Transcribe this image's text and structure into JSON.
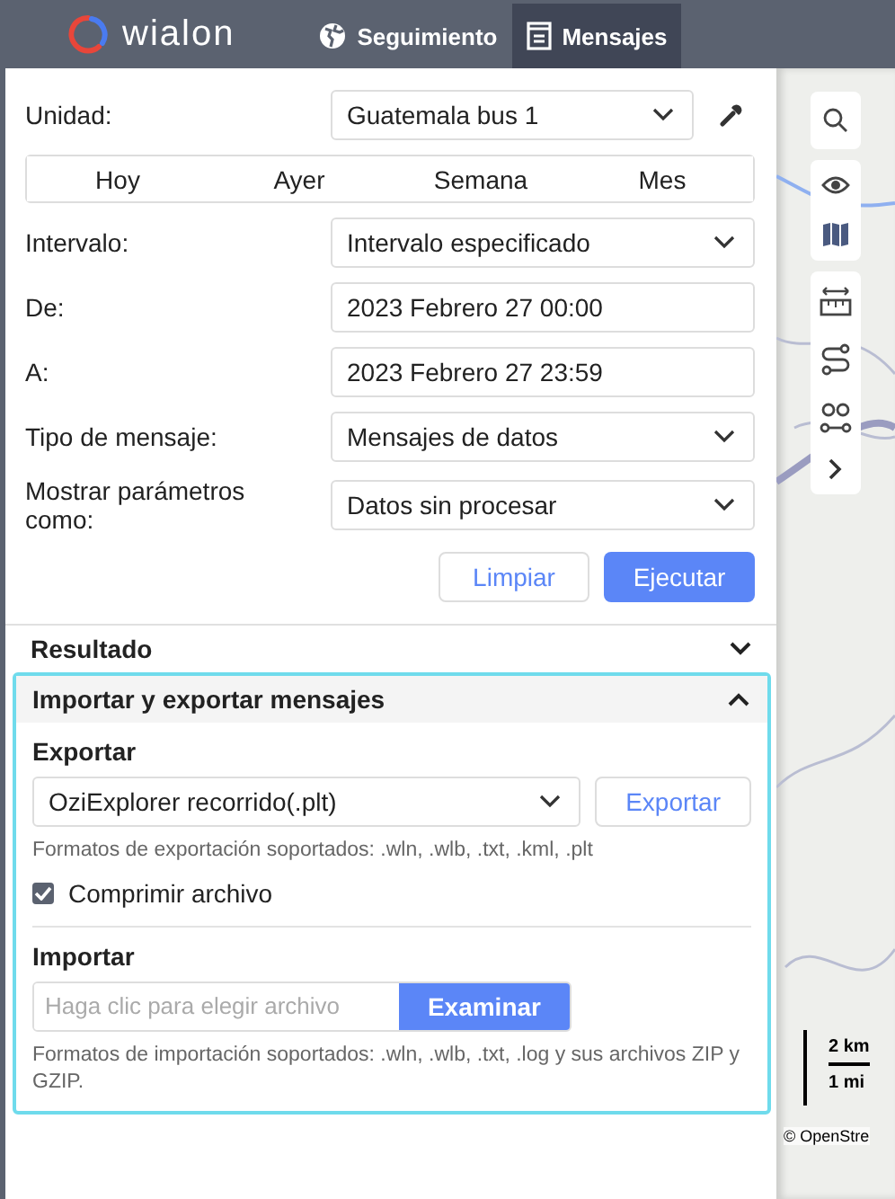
{
  "header": {
    "logo": "wialon",
    "tabs": [
      {
        "label": "Seguimiento",
        "selected": false
      },
      {
        "label": "Mensajes",
        "selected": true
      }
    ]
  },
  "form": {
    "unit_label": "Unidad:",
    "unit_value": "Guatemala bus 1",
    "periods": [
      {
        "label": "Hoy",
        "selected": false
      },
      {
        "label": "Ayer",
        "selected": false
      },
      {
        "label": "Semana",
        "selected": false
      },
      {
        "label": "Mes",
        "selected": false
      }
    ],
    "rows": [
      {
        "label": "Intervalo:",
        "kind": "select",
        "value": "Intervalo especificado"
      },
      {
        "label": "De:",
        "kind": "input",
        "value": "2023 Febrero 27 00:00"
      },
      {
        "label": "A:",
        "kind": "input",
        "value": "2023 Febrero 27 23:59"
      },
      {
        "label": "Tipo de mensaje:",
        "kind": "select",
        "value": "Mensajes de datos"
      },
      {
        "label": "Mostrar parámetros como:",
        "kind": "select",
        "value": "Datos sin procesar"
      }
    ],
    "buttons": [
      "Limpiar",
      "Ejecutar"
    ]
  },
  "sections": [
    {
      "title": "Resultado",
      "expanded": false
    },
    {
      "title": "Importar y exportar mensajes",
      "expanded": true
    }
  ],
  "export": {
    "heading": "Exportar",
    "format": "OziExplorer recorrido(.plt)",
    "button": "Exportar",
    "hint": "Formatos de exportación soportados: .wln, .wlb, .txt, .kml, .plt",
    "compress_label": "Comprimir archivo",
    "compress_checked": true
  },
  "import": {
    "heading": "Importar",
    "placeholder": "Haga clic para elegir archivo",
    "button": "Examinar",
    "hint": "Formatos de importación soportados: .wln, .wlb, .txt, .log y sus archivos ZIP y GZIP."
  },
  "map": {
    "scale_km": "2 km",
    "scale_mi": "1 mi",
    "attribution": "© OpenStre"
  }
}
